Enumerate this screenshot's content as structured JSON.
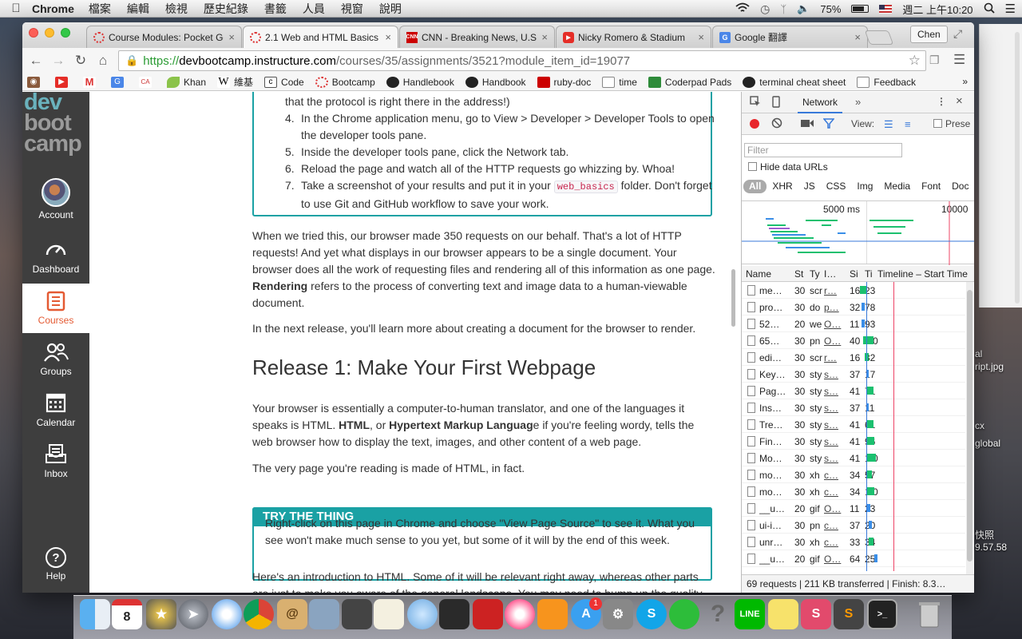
{
  "menubar": {
    "app": "Chrome",
    "items": [
      "檔案",
      "編輯",
      "檢視",
      "歷史紀錄",
      "書籤",
      "人員",
      "視窗",
      "說明"
    ],
    "battery": "75%",
    "clock": "週二 上午10:20"
  },
  "desktop": {
    "labels": [
      "al",
      "ript.jpg",
      "cx",
      "global",
      "快照",
      "9.57.58"
    ]
  },
  "browser": {
    "tabs": [
      {
        "title": "Course Modules: Pocket Go"
      },
      {
        "title": "2.1 Web and HTML Basics"
      },
      {
        "title": "CNN - Breaking News, U.S"
      },
      {
        "title": "Nicky Romero & Stadium"
      },
      {
        "title": "Google 翻譯"
      }
    ],
    "user": "Chen",
    "url": {
      "scheme": "https://",
      "host": "devbootcamp.instructure.com",
      "path": "/courses/35/assignments/3521?module_item_id=19077"
    },
    "bookmarks": [
      "Khan",
      "維基",
      "Code",
      "Bootcamp",
      "Handlebook",
      "Handbook",
      "ruby-doc",
      "time",
      "Coderpad Pads",
      "terminal cheat sheet",
      "Feedback"
    ],
    "bookmark_icon_labels": [
      "CA",
      "W"
    ]
  },
  "canvas_nav": {
    "logo": [
      "dev",
      "boot",
      "camp"
    ],
    "items": [
      {
        "label": "Account",
        "icon": "avatar"
      },
      {
        "label": "Dashboard",
        "icon": "speedometer-icon"
      },
      {
        "label": "Courses",
        "icon": "courses-icon"
      },
      {
        "label": "Groups",
        "icon": "groups-icon"
      },
      {
        "label": "Calendar",
        "icon": "calendar-icon"
      },
      {
        "label": "Inbox",
        "icon": "inbox-icon"
      },
      {
        "label": "Help",
        "icon": "help-icon"
      }
    ],
    "help_glyph": "?"
  },
  "article": {
    "step_top": "that the protocol is right there in the address!)",
    "steps": [
      {
        "n": "4.",
        "text": "In the Chrome application menu, go to View > Developer > Developer Tools to open the developer tools pane."
      },
      {
        "n": "5.",
        "text": "Inside the developer tools pane, click the Network tab."
      },
      {
        "n": "6.",
        "text": "Reload the page and watch all of the HTTP requests go whizzing by. Whoa!"
      }
    ],
    "step7": {
      "n": "7.",
      "pre": "Take a screenshot of your results and put it in your ",
      "code": "web_basics",
      "post": " folder. Don't forget to use Git and GitHub workflow to save your work."
    },
    "para1_a": "When we tried this, our browser made 350 requests on our behalf. That's a lot of HTTP requests! And yet what displays in our browser appears to be a single document. Your browser does all the work of requesting files and rendering all of this information as one page. ",
    "para1_bold": "Rendering",
    "para1_b": " refers to the process of converting text and image data to a human-viewable document.",
    "para2": "In the next release, you'll learn more about creating a document for the browser to render.",
    "heading": "Release 1: Make Your First Webpage",
    "para3_a": "Your browser is essentially a computer-to-human translator, and one of the languages it speaks is HTML. ",
    "para3_b1": "HTML",
    "para3_c": ", or ",
    "para3_b2": "Hypertext Markup Languag",
    "para3_d": "e if you're feeling wordy, tells the web browser how to display the text, images, and other content of a web page.",
    "para4": "The very page you're reading is made of HTML, in fact.",
    "try_title": "TRY THE THING",
    "try_text": "Right-click on this page in Chrome and choose \"View Page Source\" to see it. What you see won't make much sense to you yet, but some of it will by the end of this week.",
    "para5": "Here's an introduction to HTML. Some of it will be relevant right away, whereas other parts are just to make you aware of the general landscape. You may need to bump up the quality setting"
  },
  "devtools": {
    "tab": "Network",
    "more_glyph": "»",
    "view_label": "View:",
    "preserve": "Prese",
    "filter_placeholder": "Filter",
    "hide_data_urls": "Hide data URLs",
    "types": [
      "All",
      "XHR",
      "JS",
      "CSS",
      "Img",
      "Media",
      "Font",
      "Doc"
    ],
    "overview_ticks": [
      "5000 ms",
      "10000"
    ],
    "columns": [
      "Name",
      "St",
      "Ty",
      "I…",
      "Si",
      "Ti",
      "Timeline – Start Time"
    ],
    "requests": [
      {
        "name": "me…",
        "status": "30",
        "type": "scr",
        "init": "r…",
        "size": "16",
        "time": "23",
        "color": "#1bc06f",
        "start": 0.28,
        "len": 0.04
      },
      {
        "name": "pro…",
        "status": "30",
        "type": "do",
        "init": "p…",
        "size": "32",
        "time": "78",
        "color": "#3a8ee8",
        "start": 0.29,
        "len": 0.02
      },
      {
        "name": "52…",
        "status": "20",
        "type": "we",
        "init": "O…",
        "size": "11",
        "time": "93",
        "color": "#3a8ee8",
        "start": 0.29,
        "len": 0.02
      },
      {
        "name": "65…",
        "status": "30",
        "type": "pn",
        "init": "O…",
        "size": "40",
        "time": "1.0",
        "color": "#1bc06f",
        "start": 0.3,
        "len": 0.07
      },
      {
        "name": "edi…",
        "status": "30",
        "type": "scr",
        "init": "r…",
        "size": "16",
        "time": "32",
        "color": "#1bc06f",
        "start": 0.31,
        "len": 0.03
      },
      {
        "name": "Key…",
        "status": "30",
        "type": "sty",
        "init": "s…",
        "size": "37",
        "time": "17",
        "color": "#3a8ee8",
        "start": 0.32,
        "len": 0.02
      },
      {
        "name": "Pag…",
        "status": "30",
        "type": "sty",
        "init": "s…",
        "size": "41",
        "time": "71",
        "color": "#1bc06f",
        "start": 0.32,
        "len": 0.05
      },
      {
        "name": "Ins…",
        "status": "30",
        "type": "sty",
        "init": "s…",
        "size": "37",
        "time": "11",
        "color": "#3a8ee8",
        "start": 0.32,
        "len": 0.02
      },
      {
        "name": "Tre…",
        "status": "30",
        "type": "sty",
        "init": "s…",
        "size": "41",
        "time": "61",
        "color": "#1bc06f",
        "start": 0.32,
        "len": 0.05
      },
      {
        "name": "Fin…",
        "status": "30",
        "type": "sty",
        "init": "s…",
        "size": "41",
        "time": "96",
        "color": "#1bc06f",
        "start": 0.32,
        "len": 0.06
      },
      {
        "name": "Mo…",
        "status": "30",
        "type": "sty",
        "init": "s…",
        "size": "41",
        "time": "1.0",
        "color": "#1bc06f",
        "start": 0.32,
        "len": 0.07
      },
      {
        "name": "mo…",
        "status": "30",
        "type": "xh",
        "init": "c…",
        "size": "34",
        "time": "57",
        "color": "#1bc06f",
        "start": 0.32,
        "len": 0.04
      },
      {
        "name": "mo…",
        "status": "30",
        "type": "xh",
        "init": "c…",
        "size": "34",
        "time": "1.0",
        "color": "#1bc06f",
        "start": 0.33,
        "len": 0.05
      },
      {
        "name": "__u…",
        "status": "20",
        "type": "gif",
        "init": "O…",
        "size": "11",
        "time": "23",
        "color": "#3a8ee8",
        "start": 0.33,
        "len": 0.02
      },
      {
        "name": "ui-i…",
        "status": "30",
        "type": "pn",
        "init": "c…",
        "size": "37",
        "time": "20",
        "color": "#3a8ee8",
        "start": 0.34,
        "len": 0.02
      },
      {
        "name": "unr…",
        "status": "30",
        "type": "xh",
        "init": "c…",
        "size": "33",
        "time": "34",
        "color": "#1bc06f",
        "start": 0.34,
        "len": 0.03
      },
      {
        "name": "__u…",
        "status": "20",
        "type": "gif",
        "init": "O…",
        "size": "64",
        "time": "25",
        "color": "#3a8ee8",
        "start": 0.38,
        "len": 0.02
      }
    ],
    "summary": "69 requests | 211 KB transferred | Finish: 8.3…"
  },
  "dock": {
    "calendar_day": "8",
    "badges": [
      "1"
    ],
    "help_glyph": "?"
  }
}
